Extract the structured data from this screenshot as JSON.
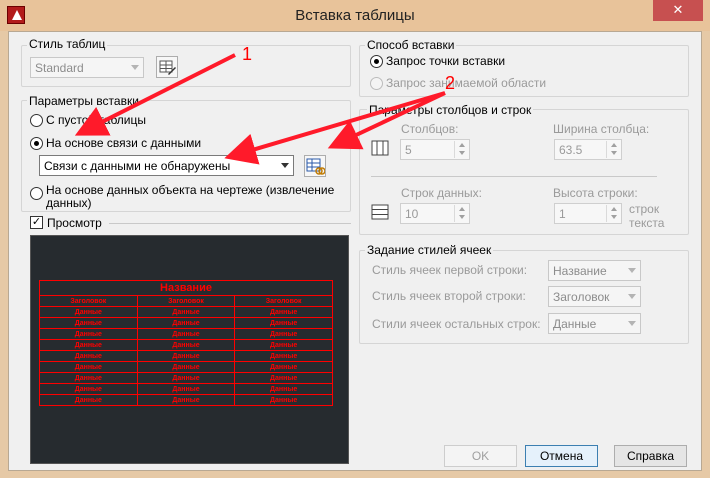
{
  "window": {
    "title": "Вставка таблицы"
  },
  "table_style": {
    "group_title": "Стиль таблиц",
    "value": "Standard"
  },
  "insert_params": {
    "group_title": "Параметры вставки",
    "option_empty": "С пустой таблицы",
    "option_data_link": "На основе связи с данными",
    "data_link_value": "Связи с данными не обнаружены",
    "option_object_data": "На основе данных объекта на чертеже (извлечение данных)"
  },
  "preview": {
    "checkbox_label": "Просмотр",
    "checked": "✓",
    "table": {
      "title": "Название",
      "headers": [
        "Заголовок",
        "Заголовок",
        "Заголовок"
      ],
      "cell": "Данные",
      "data_rows": 9
    }
  },
  "insert_method": {
    "group_title": "Способ вставки",
    "option_point": "Запрос точки вставки",
    "option_window": "Запрос занимаемой области"
  },
  "rows_cols": {
    "group_title": "Параметры столбцов и строк",
    "columns_label": "Столбцов:",
    "columns_value": "5",
    "col_width_label": "Ширина столбца:",
    "col_width_value": "63.5",
    "data_rows_label": "Строк данных:",
    "data_rows_value": "10",
    "row_height_label": "Высота строки:",
    "row_height_value": "1",
    "row_height_unit": "строк текста"
  },
  "cell_styles": {
    "group_title": "Задание стилей ячеек",
    "first_row_label": "Стиль ячеек первой строки:",
    "first_row_value": "Название",
    "second_row_label": "Стиль ячеек второй строки:",
    "second_row_value": "Заголовок",
    "other_rows_label": "Стили ячеек остальных строк:",
    "other_rows_value": "Данные"
  },
  "buttons": {
    "ok": "OK",
    "cancel": "Отмена",
    "help": "Справка"
  },
  "annotations": {
    "one": "1",
    "two": "2"
  },
  "colors": {
    "annotation": "#ff1a2a",
    "preview_bg": "#262b2f",
    "preview_table": "#ff0000"
  }
}
